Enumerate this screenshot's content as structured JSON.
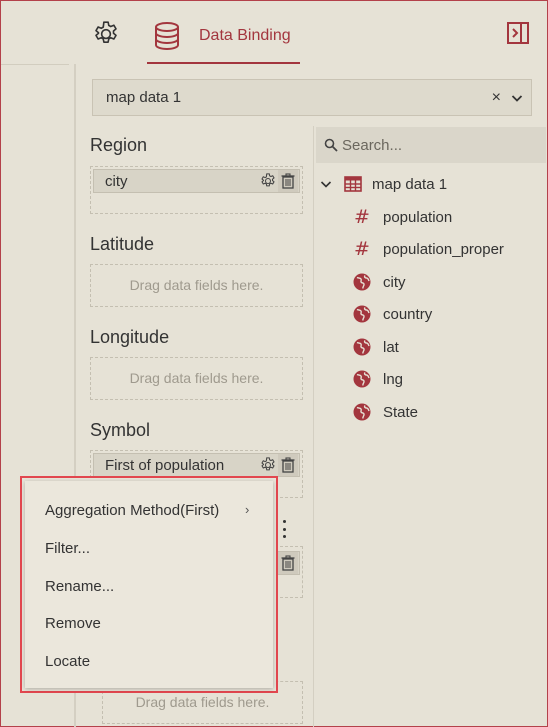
{
  "header": {
    "tab_label": "Data Binding"
  },
  "dataset": {
    "selected": "map data 1",
    "clear_glyph": "×"
  },
  "sections": {
    "region": {
      "title": "Region",
      "chip": "city"
    },
    "latitude": {
      "title": "Latitude",
      "hint": "Drag data fields here."
    },
    "longitude": {
      "title": "Longitude",
      "hint": "Drag data fields here."
    },
    "symbol": {
      "title": "Symbol",
      "chip": "First of population"
    },
    "bottom": {
      "hint": "Drag data fields here."
    }
  },
  "fields_panel": {
    "search_placeholder": "Search...",
    "root": "map data 1",
    "fields": [
      {
        "name": "population",
        "type": "number"
      },
      {
        "name": "population_proper",
        "type": "number"
      },
      {
        "name": "city",
        "type": "geo"
      },
      {
        "name": "country",
        "type": "geo"
      },
      {
        "name": "lat",
        "type": "geo"
      },
      {
        "name": "lng",
        "type": "geo"
      },
      {
        "name": "State",
        "type": "geo"
      }
    ]
  },
  "context_menu": {
    "items": [
      "Aggregation Method(First)",
      "Filter...",
      "Rename...",
      "Remove",
      "Locate"
    ]
  },
  "colors": {
    "accent": "#a3363e",
    "highlight_border": "#e2474f",
    "background": "#e6e2d6"
  },
  "icons": {
    "settings_tab": "gear-icon",
    "binding_tab": "database-icon",
    "panel_toggle": "sidebar-toggle-icon",
    "root": "table-icon",
    "number_field": "hash-icon",
    "geo_field": "globe-icon"
  }
}
